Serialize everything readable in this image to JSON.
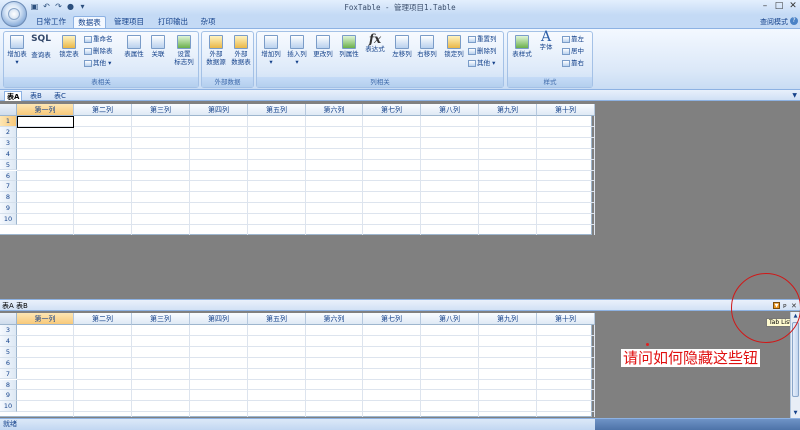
{
  "title_bar": {
    "title": "FoxTable - 管理项目1.Table"
  },
  "tabs": [
    "日常工作",
    "数据表",
    "管理项目",
    "打印输出",
    "杂项"
  ],
  "view_mode": "查阅模式",
  "ribbon": {
    "groups": [
      "表相关",
      "外部数据",
      "列相关",
      "样式"
    ],
    "table_buttons": {
      "add_table": "增加表",
      "query_table": "查询表",
      "lock_table": "锁定表",
      "rename": "重命名",
      "delete_table": "删除表",
      "other": "其他",
      "table_props": "表属性",
      "relation": "关联",
      "set_title_col_1": "设置",
      "set_title_col_2": "标志列"
    },
    "sql_label": "SQL",
    "external_buttons": {
      "ext_source_1": "外部",
      "ext_source_2": "数据源",
      "ext_table_1": "外部",
      "ext_table_2": "数据表"
    },
    "column_buttons": {
      "add_col": "增加列",
      "insert_col": "插入列",
      "modify_col": "更改列",
      "col_props": "列属性",
      "expression_col": "表达式",
      "move_left": "左移列",
      "move_right": "右移列",
      "lock_col": "锁定列",
      "reset_col": "重置列",
      "delete_col": "删除列",
      "other": "其他"
    },
    "fx_label": "fx",
    "style_buttons": {
      "table_style": "表样式",
      "font": "字体",
      "align_left": "靠左",
      "align_center": "居中",
      "align_right": "靠右"
    }
  },
  "data_tabs_top": [
    "表A",
    "表B",
    "表C"
  ],
  "columns": [
    "第一列",
    "第二列",
    "第三列",
    "第四列",
    "第五列",
    "第六列",
    "第七列",
    "第八列",
    "第九列",
    "第十列"
  ],
  "grid_top_rows": [
    "1",
    "2",
    "3",
    "4",
    "5",
    "6",
    "7",
    "8",
    "9",
    "10"
  ],
  "split_bar": {
    "label": "表A 表B"
  },
  "grid_bottom_rows": [
    "3",
    "4",
    "5",
    "6",
    "7",
    "8",
    "9",
    "10"
  ],
  "tab_list_tooltip": "Tab List",
  "annotation": "请问如何隐藏这些钮",
  "status_text": "就绪"
}
